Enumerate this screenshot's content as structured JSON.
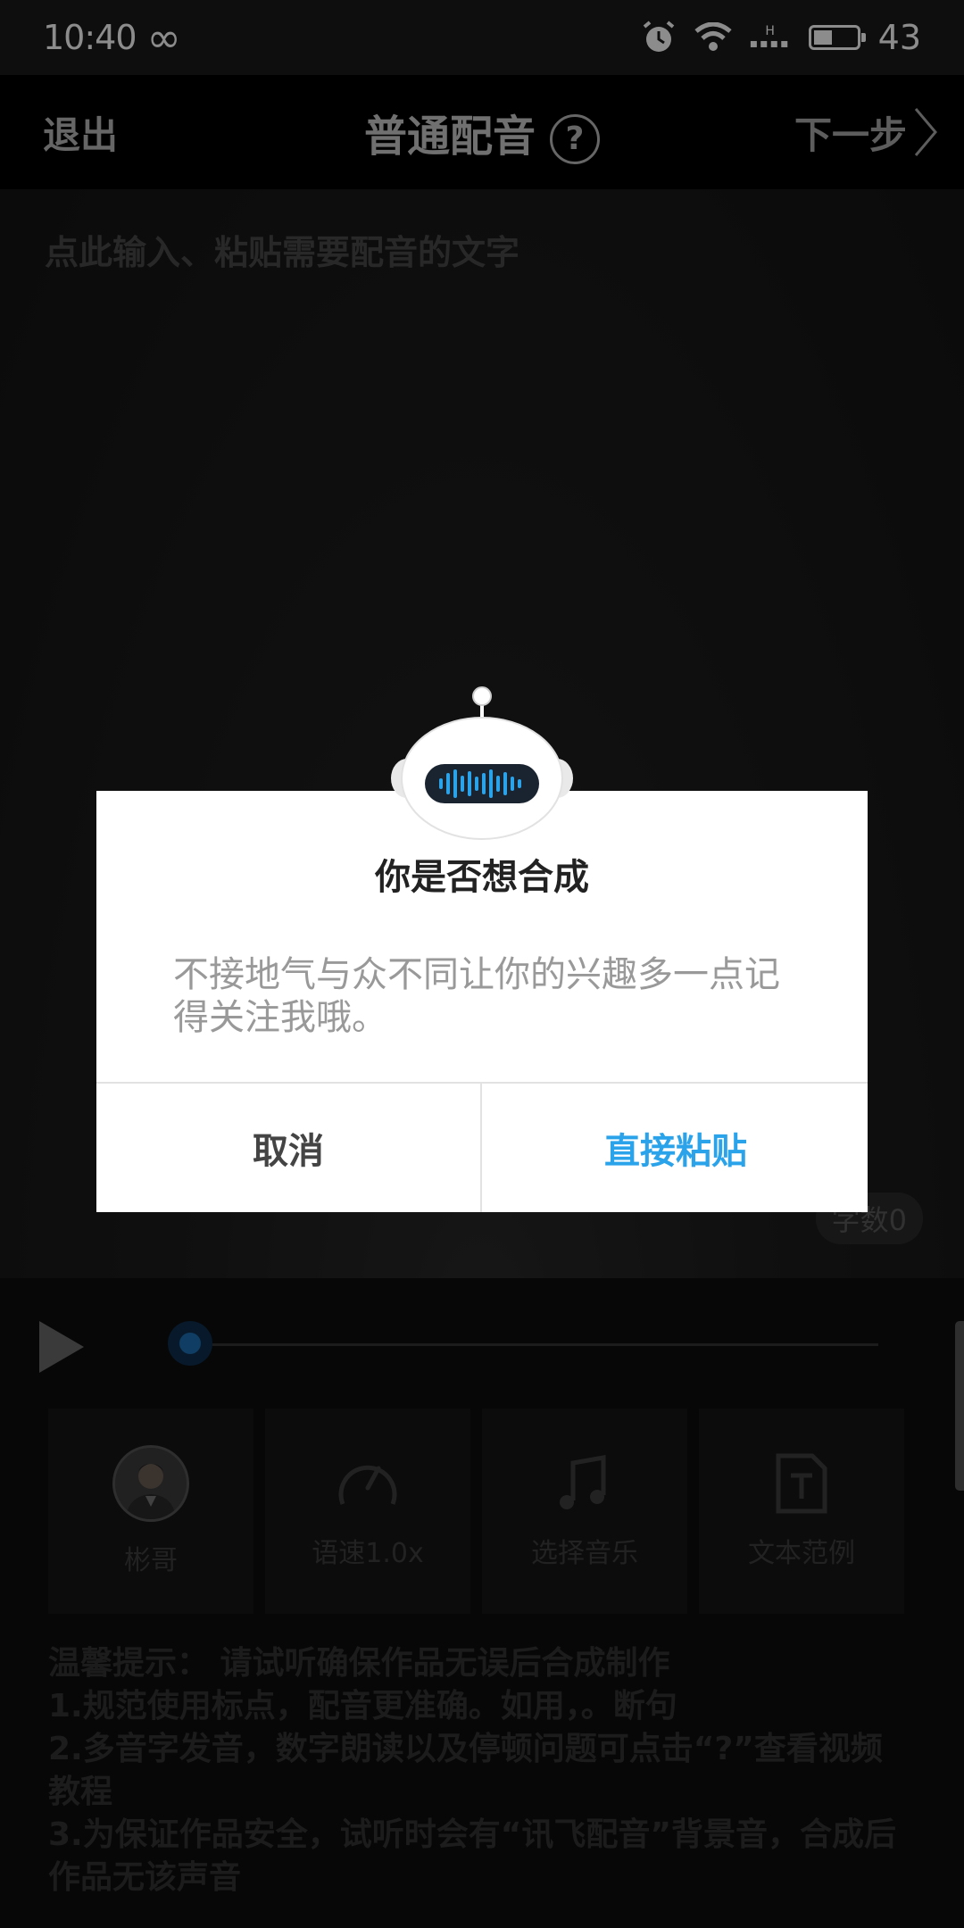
{
  "status_bar": {
    "time": "10:40",
    "infinity": "∞",
    "network": "H",
    "battery": "43",
    "battery_percent": 43
  },
  "header": {
    "exit": "退出",
    "title": "普通配音",
    "help": "?",
    "next": "下一步"
  },
  "editor": {
    "placeholder": "点此输入、粘贴需要配音的文字",
    "count": "字数0"
  },
  "player": {
    "progress": 0
  },
  "tools": [
    {
      "label": "彬哥"
    },
    {
      "label": "语速1.0x"
    },
    {
      "label": "选择音乐"
    },
    {
      "label": "文本范例"
    }
  ],
  "tips": [
    "温馨提示： 请试听确保作品无误后合成制作",
    "1.规范使用标点，配音更准确。如用，。断句",
    "2.多音字发音，数字朗读以及停顿问题可点击“?”查看视频教程",
    "3.为保证作品安全，试听时会有“讯飞配音”背景音，合成后作品无该声音"
  ],
  "dialog": {
    "title": "你是否想合成",
    "message": "不接地气与众不同让你的兴趣多一点记得关注我哦。",
    "cancel": "取消",
    "confirm": "直接粘贴"
  },
  "colors": {
    "accent": "#2aa3ea",
    "dialog_bg": "#ffffff"
  }
}
